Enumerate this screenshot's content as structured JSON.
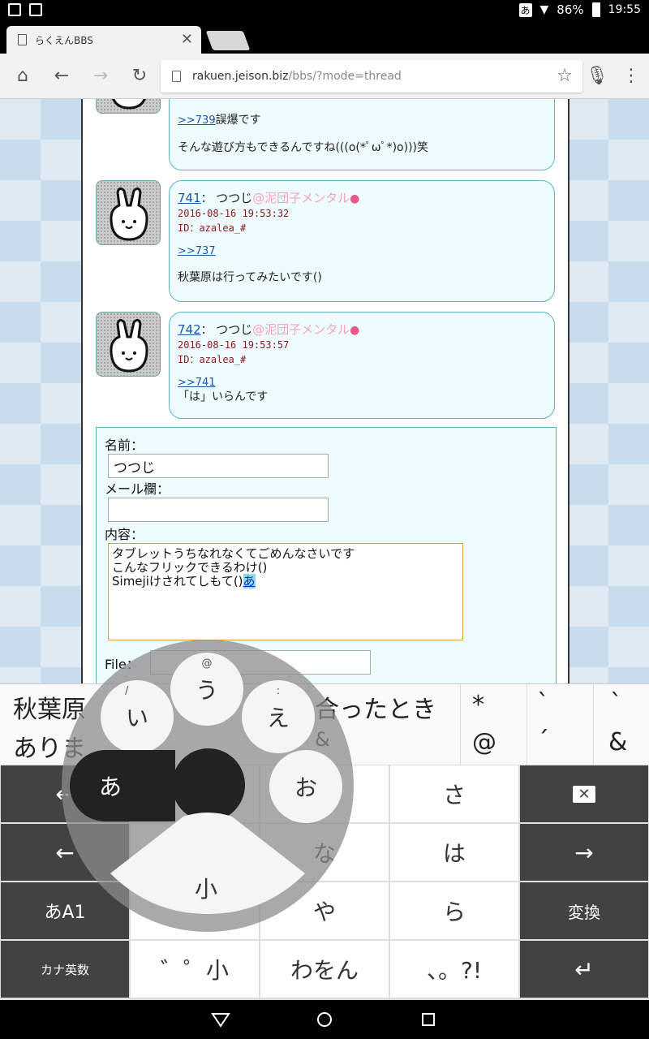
{
  "status_bar": {
    "ime_indicator": "あ",
    "battery": "86%",
    "time": "19:55"
  },
  "browser": {
    "tab_title": "らくえんBBS",
    "url_host": "rakuen.jeison.biz",
    "url_path": "/bbs/?mode=thread"
  },
  "posts": [
    {
      "anchor": ">>739",
      "body_after_anchor": "誤爆です",
      "body": "そんな遊び方もできるんですね(((o(*ﾟωﾟ*)o)))笑"
    },
    {
      "num": "741",
      "sep": "：",
      "name": "つつじ",
      "trip": "@泥団子メンタル",
      "date": "2016-08-16 19:53:32",
      "uid": "ID：azalea_#",
      "anchor": ">>737",
      "body": "秋葉原は行ってみたいです()"
    },
    {
      "num": "742",
      "sep": "：",
      "name": "つつじ",
      "trip": "@泥団子メンタル",
      "date": "2016-08-16 19:53:57",
      "uid": "ID：azalea_#",
      "anchor": ">>741",
      "body": "「は」いらんです"
    }
  ],
  "form": {
    "name_label": "名前：",
    "name_value": "つつじ",
    "mail_label": "メール欄：",
    "mail_value": "",
    "content_label": "内容：",
    "content_line1": "タブレットうちなれなくてごめんなさいです",
    "content_line2": "こんなフリックできるわけ()",
    "content_line3": "Simejiけされてしもて()",
    "content_composing": "あ",
    "file_label": "File："
  },
  "keyboard": {
    "candidates": [
      {
        "top": "秋葉原",
        "bottom": "ありま"
      },
      {
        "top": "合ったとき",
        "bottom": "&"
      },
      {
        "top": "*",
        "bottom": "@"
      },
      {
        "top": "`",
        "bottom": "´"
      },
      {
        "top": "`",
        "bottom": "&"
      }
    ],
    "keys": {
      "sa": "さ",
      "na": "な",
      "ha": "は",
      "ya": "や",
      "ra": "ら",
      "henkan": "変換",
      "mode": "あA1",
      "kana_eisu": "カナ英数",
      "dakuten": "゛゜小",
      "wawon": "わをん",
      "punct": "、。?!"
    },
    "flick": {
      "center": "あ",
      "up": "う",
      "up_sup": "@",
      "left": "い",
      "left_sup": "/",
      "right_up": "え",
      "right_up_sup": ":",
      "right": "お",
      "down": "小"
    }
  }
}
